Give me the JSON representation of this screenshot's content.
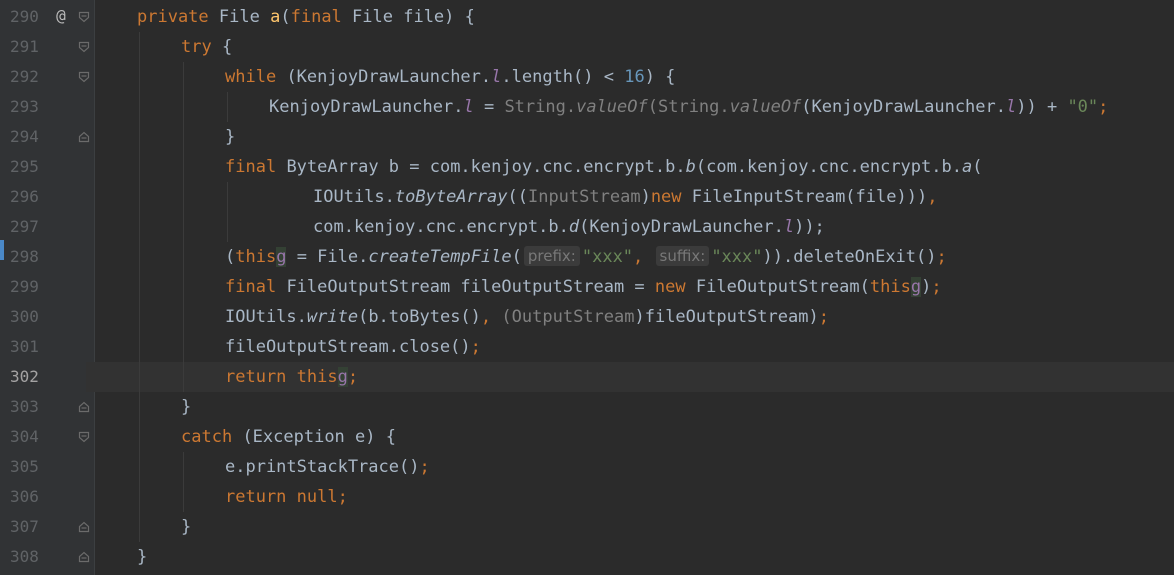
{
  "colors": {
    "background": "#2b2b2b",
    "gutter": "#313335",
    "keyword": "#cc7832",
    "number": "#6897bb",
    "string": "#6a8759",
    "field": "#9876aa",
    "default_text": "#a9b7c6",
    "line_number": "#606366"
  },
  "editor": {
    "current_line": "302",
    "lines": [
      {
        "num": "290",
        "marker": "@",
        "t": {
          "a": "private",
          "b": "File",
          "c": "a",
          "d": "(",
          "e": "final",
          "f": "File file) {"
        }
      },
      {
        "num": "291",
        "t": {
          "a": "try",
          "b": "{"
        }
      },
      {
        "num": "292",
        "t": {
          "a": "while",
          "b": "(KenjoyDrawLauncher.",
          "c": "l",
          "d": ".length() < ",
          "e": "16",
          "f": ") {"
        }
      },
      {
        "num": "293",
        "t": {
          "a": "KenjoyDrawLauncher.",
          "b": "l",
          "c": " = ",
          "d": "String.",
          "e": "valueOf",
          "f": "(String.",
          "g": "valueOf",
          "h": "(KenjoyDrawLauncher.",
          "i": "l",
          "j": ")) + ",
          "k": "\"0\"",
          "l": ";"
        }
      },
      {
        "num": "294",
        "t": {
          "a": "}"
        }
      },
      {
        "num": "295",
        "t": {
          "a": "final",
          "b": "ByteArray b = com.kenjoy.cnc.encrypt.b.",
          "c": "b",
          "d": "(com.kenjoy.cnc.encrypt.b.",
          "e": "a",
          "f": "("
        }
      },
      {
        "num": "296",
        "t": {
          "a": "IOUtils.",
          "b": "toByteArray",
          "c": "((",
          "d": "InputStream",
          "e": ")",
          "f": "new",
          "g": "FileInputStream(file))",
          ",": ")",
          "h": ","
        }
      },
      {
        "num": "297",
        "t": {
          "a": "com.kenjoy.cnc.encrypt.b.",
          "b": "d",
          "c": "(KenjoyDrawLauncher.",
          "d": "l",
          "e": "));"
        }
      },
      {
        "num": "298",
        "t": {
          "a": "(",
          "b": "this",
          ".": ".",
          "c": "g",
          "d": " = File.",
          "e": "createTempFile",
          "f": "(",
          "g": "prefix:",
          "h": "\"xxx\"",
          "i": ",",
          "j": "suffix:",
          "k": "\"xxx\"",
          "l": ")).deleteOnExit()",
          "m": ";"
        }
      },
      {
        "num": "299",
        "t": {
          "a": "final",
          "b": "FileOutputStream fileOutputStream = ",
          "c": "new",
          "d": "FileOutputStream(",
          "e": "this",
          ".": ".",
          "f": "g",
          "g": ")",
          "h": ";"
        }
      },
      {
        "num": "300",
        "t": {
          "a": "IOUtils.",
          "b": "write",
          "c": "(b.toBytes()",
          ",": ",",
          "d": "(",
          "e": "OutputStream",
          "f": ")fileOutputStream)",
          "g": ";"
        }
      },
      {
        "num": "301",
        "t": {
          "a": "fileOutputStream.close()",
          "b": ";"
        }
      },
      {
        "num": "302",
        "t": {
          "a": "return",
          "b": "this",
          ".": ".",
          "c": "g",
          "d": ";"
        }
      },
      {
        "num": "303",
        "t": {
          "a": "}"
        }
      },
      {
        "num": "304",
        "t": {
          "a": "catch",
          "b": "(Exception e) {"
        }
      },
      {
        "num": "305",
        "t": {
          "a": "e.printStackTrace()",
          "b": ";"
        }
      },
      {
        "num": "306",
        "t": {
          "a": "return",
          "b": "null",
          "c": ";"
        }
      },
      {
        "num": "307",
        "t": {
          "a": "}"
        }
      },
      {
        "num": "308",
        "t": {
          "a": "}"
        }
      }
    ]
  }
}
